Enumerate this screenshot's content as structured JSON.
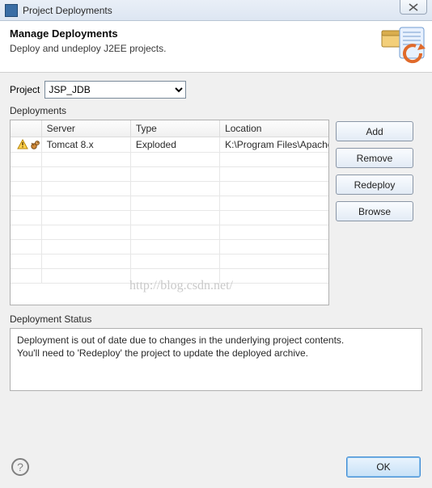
{
  "window": {
    "title": "Project Deployments"
  },
  "header": {
    "title": "Manage Deployments",
    "subtitle": "Deploy and undeploy J2EE projects."
  },
  "project": {
    "label": "Project",
    "selected": "JSP_JDB",
    "options": [
      "JSP_JDB"
    ]
  },
  "deployments": {
    "label": "Deployments",
    "columns": {
      "server": "Server",
      "type": "Type",
      "location": "Location"
    },
    "rows": [
      {
        "server": "Tomcat  8.x",
        "type": "Exploded",
        "location": "K:\\Program Files\\Apache Software"
      }
    ]
  },
  "buttons": {
    "add": "Add",
    "remove": "Remove",
    "redeploy": "Redeploy",
    "browse": "Browse",
    "ok": "OK"
  },
  "status": {
    "label": "Deployment Status",
    "line1": "Deployment is out of date due to changes in the underlying project contents.",
    "line2": "You'll need to 'Redeploy' the project to update the deployed archive."
  },
  "watermark": "http://blog.csdn.net/",
  "icons": {
    "warning": "warning-icon",
    "server": "server-icon",
    "help": "?"
  }
}
